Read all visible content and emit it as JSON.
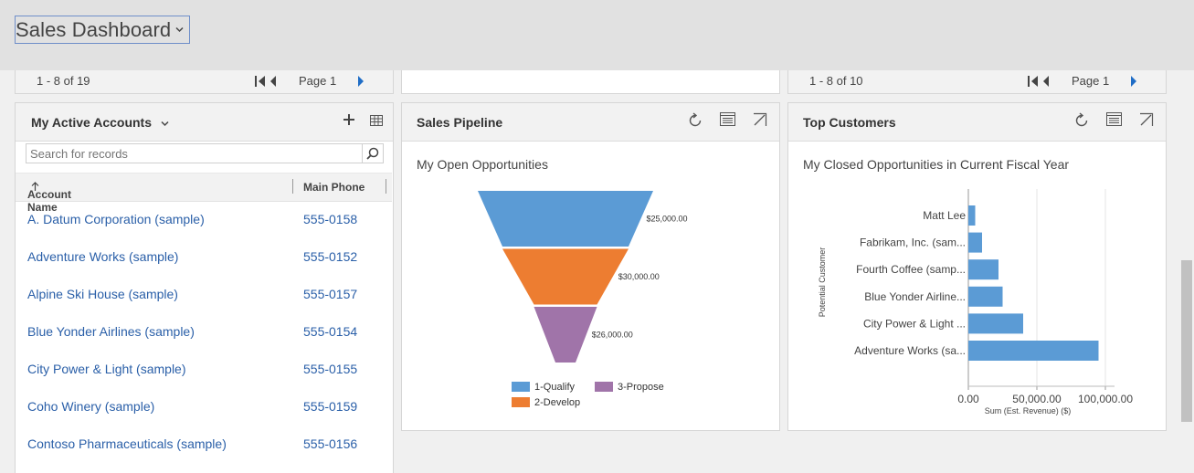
{
  "header": {
    "title": "Sales Dashboard"
  },
  "pagers": [
    {
      "count": "1 - 8 of 19",
      "page": "Page 1"
    },
    {
      "count": "1 - 8 of 10",
      "page": "Page 1"
    }
  ],
  "accounts": {
    "title": "My Active Accounts",
    "search_placeholder": "Search for records",
    "columns": [
      "Account Name",
      "Main Phone"
    ],
    "rows": [
      {
        "name": "A. Datum Corporation (sample)",
        "phone": "555-0158"
      },
      {
        "name": "Adventure Works (sample)",
        "phone": "555-0152"
      },
      {
        "name": "Alpine Ski House (sample)",
        "phone": "555-0157"
      },
      {
        "name": "Blue Yonder Airlines (sample)",
        "phone": "555-0154"
      },
      {
        "name": "City Power & Light (sample)",
        "phone": "555-0155"
      },
      {
        "name": "Coho Winery (sample)",
        "phone": "555-0159"
      },
      {
        "name": "Contoso Pharmaceuticals (sample)",
        "phone": "555-0156"
      }
    ]
  },
  "pipeline": {
    "title": "Sales Pipeline",
    "subtitle": "My Open Opportunities"
  },
  "customers": {
    "title": "Top Customers",
    "subtitle": "My Closed Opportunities in Current Fiscal Year"
  },
  "colors": {
    "accent": "#5b9bd5",
    "qualify": "#5b9bd5",
    "develop": "#ed7d31",
    "propose": "#a074a9",
    "link": "#2a5fa8"
  },
  "chart_data": [
    {
      "type": "funnel",
      "stages": [
        {
          "name": "1-Qualify",
          "value": 25000,
          "label": "$25,000.00",
          "color": "#5b9bd5"
        },
        {
          "name": "2-Develop",
          "value": 30000,
          "label": "$30,000.00",
          "color": "#ed7d31"
        },
        {
          "name": "3-Propose",
          "value": 26000,
          "label": "$26,000.00",
          "color": "#a074a9"
        }
      ],
      "legend": "bottom"
    },
    {
      "type": "bar",
      "orientation": "horizontal",
      "categories": [
        "Matt Lee",
        "Fabrikam, Inc. (sam...",
        "Fourth Coffee (samp...",
        "Blue Yonder Airline...",
        "City Power & Light ...",
        "Adventure Works (sa..."
      ],
      "values": [
        5000,
        10000,
        22000,
        25000,
        40000,
        95000
      ],
      "xlabel": "Sum (Est. Revenue) ($)",
      "ylabel": "Potential Customer",
      "xticks": [
        "0.00",
        "50,000.00",
        "100,000.00"
      ],
      "xlim": [
        0,
        100000
      ],
      "color": "#5b9bd5",
      "grid": true
    }
  ]
}
